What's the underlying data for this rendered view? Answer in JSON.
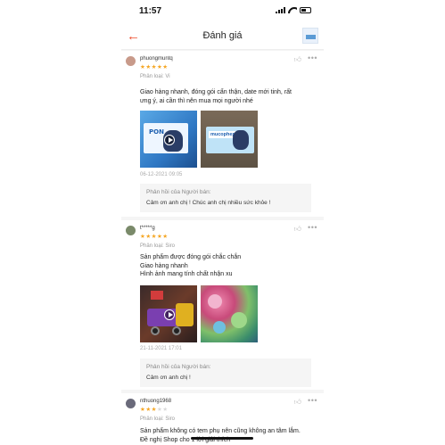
{
  "status_bar": {
    "time": "11:57"
  },
  "header": {
    "title": "Đánh giá",
    "back_icon": "arrow-left-icon"
  },
  "reviews": [
    {
      "username": "phuongmuntq",
      "stars": 5,
      "stars_text": "★★★★★",
      "variant": "Phân loại: Vi",
      "lines": [
        "Giao hàng nhanh, đóng gói cẩn thận, date mới tinh, rất",
        "ưng ý, ai cần thì nên mua mọi người nhé"
      ],
      "photo_labels": [
        "PON",
        "mucophepon"
      ],
      "date": "06-12-2021 09:05",
      "reply_title": "Phản hồi của Người bán:",
      "reply_text": "Cảm ơn anh chị ! Chúc anh chị nhiều sức khỏe !"
    },
    {
      "username": "t*****g",
      "stars": 5,
      "stars_text": "★★★★★",
      "variant": "Phân loại: Siro",
      "lines": [
        "Sản phẩm được đóng gói chắc chắn",
        "Giao hàng nhanh",
        "Hình ảnh mang tính chất nhận xu"
      ],
      "date": "21-11-2021 17:01",
      "reply_title": "Phản hồi của Người bán:",
      "reply_text": "Cảm ơn anh chị !"
    },
    {
      "username": "nthuong1968",
      "stars": 3,
      "stars_on": "★★★",
      "stars_off": "★★",
      "variant": "Phân loại: Siro",
      "lines": [
        "Sản phẩm không có tem phụ nên cũng không an tâm lắm.",
        "Đề nghị Shop cho 1 lời giải thích"
      ]
    }
  ],
  "colors": {
    "accent": "#ee4d2d",
    "star": "#f5a623",
    "reply_bg": "#f5f5f5"
  }
}
